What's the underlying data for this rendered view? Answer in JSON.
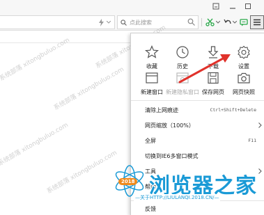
{
  "window": {
    "buttons": [
      {
        "name": "minimize-window-button",
        "icon": "minimize-icon"
      },
      {
        "name": "restore-window-button",
        "icon": "restore-icon"
      },
      {
        "name": "close-window-button",
        "icon": "close-icon"
      }
    ]
  },
  "toolbar": {
    "search_placeholder": "点此搜索",
    "search_engine_icon": "search-icon",
    "buttons": [
      "lightning-icon",
      "scissors-icon",
      "undo-icon",
      "chat-icon",
      "menu-icon"
    ]
  },
  "menu": {
    "grid_row1": [
      {
        "label": "收藏",
        "icon": "star-icon",
        "dim": false
      },
      {
        "label": "历史",
        "icon": "clock-icon",
        "dim": false
      },
      {
        "label": "下载",
        "icon": "download-icon",
        "dim": false
      },
      {
        "label": "设置",
        "icon": "gear-icon",
        "dim": false
      }
    ],
    "grid_row2": [
      {
        "label": "新建窗口",
        "icon": "new-window-icon",
        "dim": false
      },
      {
        "label": "新建隐私窗口",
        "icon": "private-window-icon",
        "dim": true
      },
      {
        "label": "保存网页",
        "icon": "save-icon",
        "dim": false
      },
      {
        "label": "网页快照",
        "icon": "camera-icon",
        "dim": false
      }
    ],
    "items": [
      {
        "label": "清除上网痕迹",
        "shortcut": "Ctrl+Shift+Delete",
        "submenu": false
      },
      {
        "label": "网页缩放（100%）",
        "shortcut": "",
        "submenu": true
      },
      {
        "label": "全屏",
        "shortcut": "F11",
        "submenu": false
      },
      {
        "label": "切换到IE6多窗口模式",
        "shortcut": "",
        "submenu": false
      },
      {
        "label": "工具",
        "shortcut": "",
        "submenu": true
      },
      {
        "label": "帮助",
        "shortcut": "",
        "submenu": false
      },
      {
        "label": "反馈",
        "shortcut": "",
        "submenu": false
      }
    ]
  },
  "watermark": {
    "logo_text": "浏览器之家",
    "logo_badge": "2018",
    "logo_url": "—关于HTTP://LIULANQI.2018.CN/—",
    "text": "系统部落 xitongbuluo.com"
  },
  "colors": {
    "accent_green": "#2aa84a",
    "accent_blue": "#1a9ad6",
    "arrow_red": "#e0322b",
    "icon_gray": "#555555"
  }
}
